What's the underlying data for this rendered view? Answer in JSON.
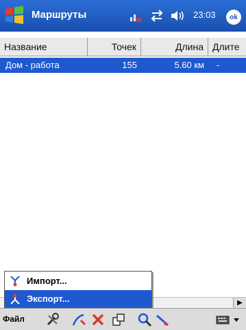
{
  "app": {
    "title": "Маршруты"
  },
  "status": {
    "time": "23:03",
    "ok_label": "ok"
  },
  "table": {
    "columns": [
      "Название",
      "Точек",
      "Длина",
      "Длите"
    ],
    "rows": [
      {
        "name": "Дом - работа",
        "points": "155",
        "length": "5.60 км",
        "duration": "-"
      }
    ]
  },
  "menu": {
    "items": [
      {
        "label": "Импорт..."
      },
      {
        "label": "Экспорт..."
      }
    ],
    "selected": "Экспорт..."
  },
  "toolbar": {
    "file_label": "Файл",
    "icons": [
      "tools-icon",
      "edit-route-icon",
      "delete-icon",
      "properties-icon",
      "search-icon",
      "navigate-icon",
      "keyboard-icon"
    ]
  },
  "colors": {
    "title_bar": "#1a4fb0",
    "selection": "#1e59d0",
    "header_bg": "#e9e9e9"
  }
}
